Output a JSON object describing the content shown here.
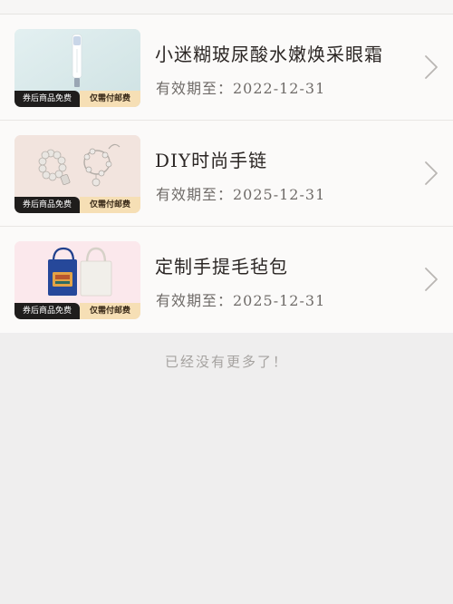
{
  "items": [
    {
      "title": "小迷糊玻尿酸水嫩焕采眼霜",
      "expiry": "有效期至：2022-12-31",
      "ribbon_left": "券后商品免费",
      "ribbon_right": "仅需付邮费",
      "thumb_bg": "#d9e9ea",
      "thumb_icon": "eye-cream-tube-icon"
    },
    {
      "title": "DIY时尚手链",
      "expiry": "有效期至：2025-12-31",
      "ribbon_left": "券后商品免费",
      "ribbon_right": "仅需付邮费",
      "thumb_bg": "#f1e2dc",
      "thumb_icon": "bracelets-icon"
    },
    {
      "title": "定制手提毛毡包",
      "expiry": "有效期至：2025-12-31",
      "ribbon_left": "券后商品免费",
      "ribbon_right": "仅需付邮费",
      "thumb_bg": "#fbe6ea",
      "thumb_icon": "felt-tote-bags-icon"
    }
  ],
  "footer": {
    "end_message": "已经没有更多了！"
  },
  "colors": {
    "page_bg": "#efeeee",
    "card_bg": "#fbfaf9",
    "ribbon_dark": "#1f1d1c",
    "ribbon_light": "#f6dfb5"
  }
}
